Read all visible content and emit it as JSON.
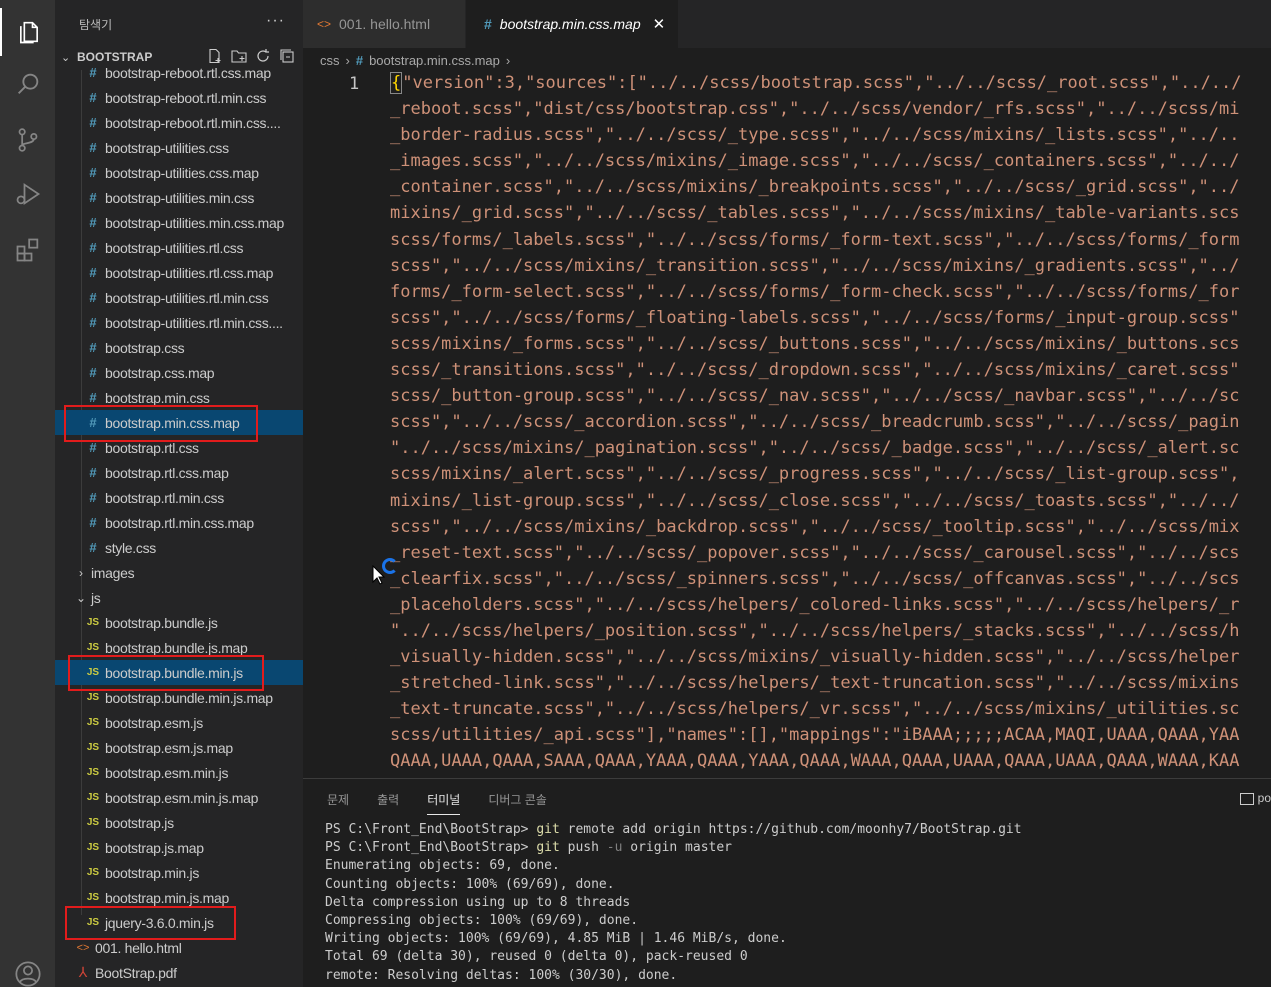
{
  "activity_bar": {
    "icons": [
      "files-icon",
      "search-icon",
      "source-control-icon",
      "run-debug-icon",
      "extensions-icon",
      "account-icon"
    ]
  },
  "sidebar": {
    "title": "탐색기",
    "more": "···",
    "section": "BOOTSTRAP",
    "items": [
      {
        "label": "bootstrap-reboot.rtl.css.map",
        "type": "css"
      },
      {
        "label": "bootstrap-reboot.rtl.min.css",
        "type": "css"
      },
      {
        "label": "bootstrap-reboot.rtl.min.css....",
        "type": "css"
      },
      {
        "label": "bootstrap-utilities.css",
        "type": "css"
      },
      {
        "label": "bootstrap-utilities.css.map",
        "type": "css"
      },
      {
        "label": "bootstrap-utilities.min.css",
        "type": "css"
      },
      {
        "label": "bootstrap-utilities.min.css.map",
        "type": "css"
      },
      {
        "label": "bootstrap-utilities.rtl.css",
        "type": "css"
      },
      {
        "label": "bootstrap-utilities.rtl.css.map",
        "type": "css"
      },
      {
        "label": "bootstrap-utilities.rtl.min.css",
        "type": "css"
      },
      {
        "label": "bootstrap-utilities.rtl.min.css....",
        "type": "css"
      },
      {
        "label": "bootstrap.css",
        "type": "css"
      },
      {
        "label": "bootstrap.css.map",
        "type": "css"
      },
      {
        "label": "bootstrap.min.css",
        "type": "css"
      },
      {
        "label": "bootstrap.min.css.map",
        "type": "css",
        "selected": true
      },
      {
        "label": "bootstrap.rtl.css",
        "type": "css"
      },
      {
        "label": "bootstrap.rtl.css.map",
        "type": "css"
      },
      {
        "label": "bootstrap.rtl.min.css",
        "type": "css"
      },
      {
        "label": "bootstrap.rtl.min.css.map",
        "type": "css"
      },
      {
        "label": "style.css",
        "type": "css"
      },
      {
        "label": "images",
        "type": "folder-closed"
      },
      {
        "label": "js",
        "type": "folder-open"
      },
      {
        "label": "bootstrap.bundle.js",
        "type": "js"
      },
      {
        "label": "bootstrap.bundle.js.map",
        "type": "js"
      },
      {
        "label": "bootstrap.bundle.min.js",
        "type": "js",
        "selected": true
      },
      {
        "label": "bootstrap.bundle.min.js.map",
        "type": "js"
      },
      {
        "label": "bootstrap.esm.js",
        "type": "js"
      },
      {
        "label": "bootstrap.esm.js.map",
        "type": "js"
      },
      {
        "label": "bootstrap.esm.min.js",
        "type": "js"
      },
      {
        "label": "bootstrap.esm.min.js.map",
        "type": "js"
      },
      {
        "label": "bootstrap.js",
        "type": "js"
      },
      {
        "label": "bootstrap.js.map",
        "type": "js"
      },
      {
        "label": "bootstrap.min.js",
        "type": "js"
      },
      {
        "label": "bootstrap.min.js.map",
        "type": "js"
      },
      {
        "label": "jquery-3.6.0.min.js",
        "type": "js"
      },
      {
        "label": "001. hello.html",
        "type": "html"
      },
      {
        "label": "BootStrap.pdf",
        "type": "pdf"
      }
    ]
  },
  "tabs": [
    {
      "label": "001. hello.html",
      "icon": "<>"
    },
    {
      "label": "bootstrap.min.css.map",
      "icon": "#",
      "close": "✕"
    }
  ],
  "breadcrumb": {
    "folder": "css",
    "sep": "›",
    "file": "bootstrap.min.css.map",
    "tail": "›"
  },
  "editor": {
    "line_number": "1",
    "lines": [
      "{\"version\":3,\"sources\":[\"../../scss/bootstrap.scss\",\"../../scss/_root.scss\",\"../../",
      "_reboot.scss\",\"dist/css/bootstrap.css\",\"../../scss/vendor/_rfs.scss\",\"../../scss/mi",
      "_border-radius.scss\",\"../../scss/_type.scss\",\"../../scss/mixins/_lists.scss\",\"../..",
      "_images.scss\",\"../../scss/mixins/_image.scss\",\"../../scss/_containers.scss\",\"../../",
      "_container.scss\",\"../../scss/mixins/_breakpoints.scss\",\"../../scss/_grid.scss\",\"../",
      "mixins/_grid.scss\",\"../../scss/_tables.scss\",\"../../scss/mixins/_table-variants.scs",
      "scss/forms/_labels.scss\",\"../../scss/forms/_form-text.scss\",\"../../scss/forms/_form",
      "scss\",\"../../scss/mixins/_transition.scss\",\"../../scss/mixins/_gradients.scss\",\"../",
      "forms/_form-select.scss\",\"../../scss/forms/_form-check.scss\",\"../../scss/forms/_for",
      "scss\",\"../../scss/forms/_floating-labels.scss\",\"../../scss/forms/_input-group.scss\"",
      "scss/mixins/_forms.scss\",\"../../scss/_buttons.scss\",\"../../scss/mixins/_buttons.scs",
      "scss/_transitions.scss\",\"../../scss/_dropdown.scss\",\"../../scss/mixins/_caret.scss\"",
      "scss/_button-group.scss\",\"../../scss/_nav.scss\",\"../../scss/_navbar.scss\",\"../../sc",
      "scss\",\"../../scss/_accordion.scss\",\"../../scss/_breadcrumb.scss\",\"../../scss/_pagin",
      "\"../../scss/mixins/_pagination.scss\",\"../../scss/_badge.scss\",\"../../scss/_alert.sc",
      "scss/mixins/_alert.scss\",\"../../scss/_progress.scss\",\"../../scss/_list-group.scss\",",
      "mixins/_list-group.scss\",\"../../scss/_close.scss\",\"../../scss/_toasts.scss\",\"../../",
      "scss\",\"../../scss/mixins/_backdrop.scss\",\"../../scss/_tooltip.scss\",\"../../scss/mix",
      "_reset-text.scss\",\"../../scss/_popover.scss\",\"../../scss/_carousel.scss\",\"../../scs",
      "_clearfix.scss\",\"../../scss/_spinners.scss\",\"../../scss/_offcanvas.scss\",\"../../scs",
      "_placeholders.scss\",\"../../scss/helpers/_colored-links.scss\",\"../../scss/helpers/_r",
      "\"../../scss/helpers/_position.scss\",\"../../scss/helpers/_stacks.scss\",\"../../scss/h",
      "_visually-hidden.scss\",\"../../scss/mixins/_visually-hidden.scss\",\"../../scss/helper",
      "_stretched-link.scss\",\"../../scss/helpers/_text-truncation.scss\",\"../../scss/mixins",
      "_text-truncate.scss\",\"../../scss/helpers/_vr.scss\",\"../../scss/mixins/_utilities.sc",
      "scss/utilities/_api.scss\"],\"names\":[],\"mappings\":\"iBAAA;;;;;ACAA,MAQI,UAAA,QAAA,YAA",
      "QAAA,UAAA,QAAA,SAAA,QAAA,YAAA,QAAA,YAAA,QAAA,WAAA,QAAA,UAAA,QAAA,UAAA,QAAA,WAAA,KAA"
    ]
  },
  "panel": {
    "tabs": [
      "문제",
      "출력",
      "터미널",
      "디버그 콘솔"
    ],
    "active_tab": "터미널",
    "right_label": "po",
    "terminal": [
      {
        "prompt": "PS C:\\Front_End\\BootStrap> ",
        "cmd": "git",
        "rest": " remote add origin https://github.com/moonhy7/BootStrap.git"
      },
      {
        "prompt": "PS C:\\Front_End\\BootStrap> ",
        "cmd": "git",
        "rest": " push ",
        "flag": "-u",
        "rest2": " origin master"
      },
      {
        "text": "Enumerating objects: 69, done."
      },
      {
        "text": "Counting objects: 100% (69/69), done."
      },
      {
        "text": "Delta compression using up to 8 threads"
      },
      {
        "text": "Compressing objects: 100% (69/69), done."
      },
      {
        "text": "Writing objects: 100% (69/69), 4.85 MiB | 1.46 MiB/s, done."
      },
      {
        "text": "Total 69 (delta 30), reused 0 (delta 0), pack-reused 0"
      },
      {
        "text": "remote: Resolving deltas: 100% (30/30), done."
      }
    ]
  }
}
